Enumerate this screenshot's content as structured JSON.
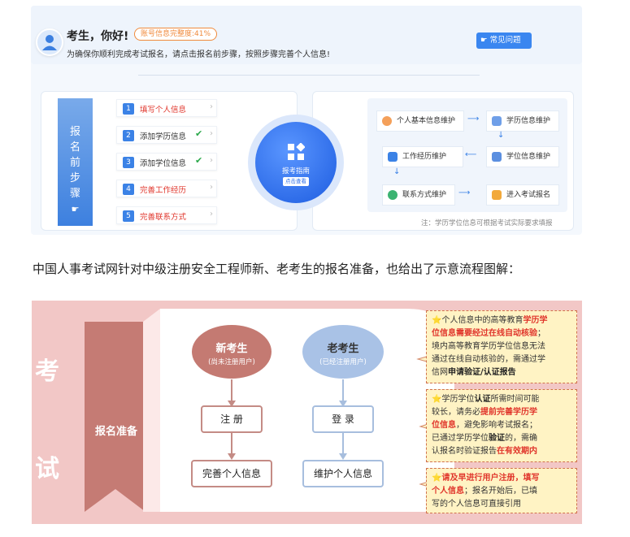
{
  "header": {
    "greeting": "考生，你好!",
    "badge": "账号信息完整度:41%",
    "subtitle": "为确保你顺利完成考试报名，请点击报名前步骤，按照步骤完善个人信息!",
    "faq_button": "常见问题"
  },
  "steps_panel": {
    "vertical_title": [
      "报",
      "名",
      "前",
      "步",
      "骤"
    ],
    "steps": [
      {
        "num": "1",
        "label": "填写个人信息",
        "status": "incomplete"
      },
      {
        "num": "2",
        "label": "添加学历信息",
        "status": "complete"
      },
      {
        "num": "3",
        "label": "添加学位信息",
        "status": "complete"
      },
      {
        "num": "4",
        "label": "完善工作经历",
        "status": "incomplete"
      },
      {
        "num": "5",
        "label": "完善联系方式",
        "status": "incomplete"
      }
    ]
  },
  "guide": {
    "title": "报考指南",
    "tag": "点击查看"
  },
  "flow": {
    "nodes": [
      "个人基本信息维护",
      "学历信息维护",
      "学位信息维护",
      "工作经历维护",
      "联系方式维护",
      "进入考试报名"
    ],
    "note": "注：学历学位信息可根据考试实际要求填报"
  },
  "intro_text": "中国人事考试网针对中级注册安全工程师新、老考生的报名准备，也给出了示意流程图解：",
  "diagram": {
    "side_chars": [
      "考",
      "试"
    ],
    "prep_label": "报名准备",
    "new_title": "新考生",
    "new_sub": "(尚未注册用户)",
    "old_title": "老考生",
    "old_sub": "(已经注册用户)",
    "new_step1": "注  册",
    "new_step2": "完善个人信息",
    "old_step1": "登  录",
    "old_step2": "维护个人信息",
    "notes": [
      {
        "lines": [
          [
            {
              "t": "⭐个人信息中的高等教育",
              "c": "n"
            },
            {
              "t": "学历学",
              "c": "r"
            }
          ],
          [
            {
              "t": "位信息需要经过在线自动核验",
              "c": "r"
            },
            {
              "t": "；",
              "c": "n"
            }
          ],
          [
            {
              "t": "境内高等教育学历学位信息无法",
              "c": "n"
            }
          ],
          [
            {
              "t": "通过在线自动核验的，需通过学",
              "c": "n"
            }
          ],
          [
            {
              "t": "信网",
              "c": "n"
            },
            {
              "t": "申请验证/认证报告",
              "c": "b"
            }
          ]
        ]
      },
      {
        "lines": [
          [
            {
              "t": "⭐学历学位",
              "c": "n"
            },
            {
              "t": "认证",
              "c": "b"
            },
            {
              "t": "所需时间可能",
              "c": "n"
            }
          ],
          [
            {
              "t": "较长，请务必",
              "c": "n"
            },
            {
              "t": "提前完善学历学",
              "c": "r"
            }
          ],
          [
            {
              "t": "位信息",
              "c": "r"
            },
            {
              "t": "，避免影响考试报名；",
              "c": "n"
            }
          ],
          [
            {
              "t": "已通过学历学位",
              "c": "n"
            },
            {
              "t": "验证",
              "c": "b"
            },
            {
              "t": "的，需确",
              "c": "n"
            }
          ],
          [
            {
              "t": "认报名时验证报告",
              "c": "n"
            },
            {
              "t": "在有效期内",
              "c": "r"
            }
          ]
        ]
      },
      {
        "lines": [
          [
            {
              "t": "⭐",
              "c": "n"
            },
            {
              "t": "请及早进行用户注册，填写",
              "c": "r"
            }
          ],
          [
            {
              "t": "个人信息",
              "c": "r"
            },
            {
              "t": "；报名开始后，已填",
              "c": "n"
            }
          ],
          [
            {
              "t": "写的个人信息可直接引用",
              "c": "n"
            }
          ]
        ]
      }
    ]
  }
}
